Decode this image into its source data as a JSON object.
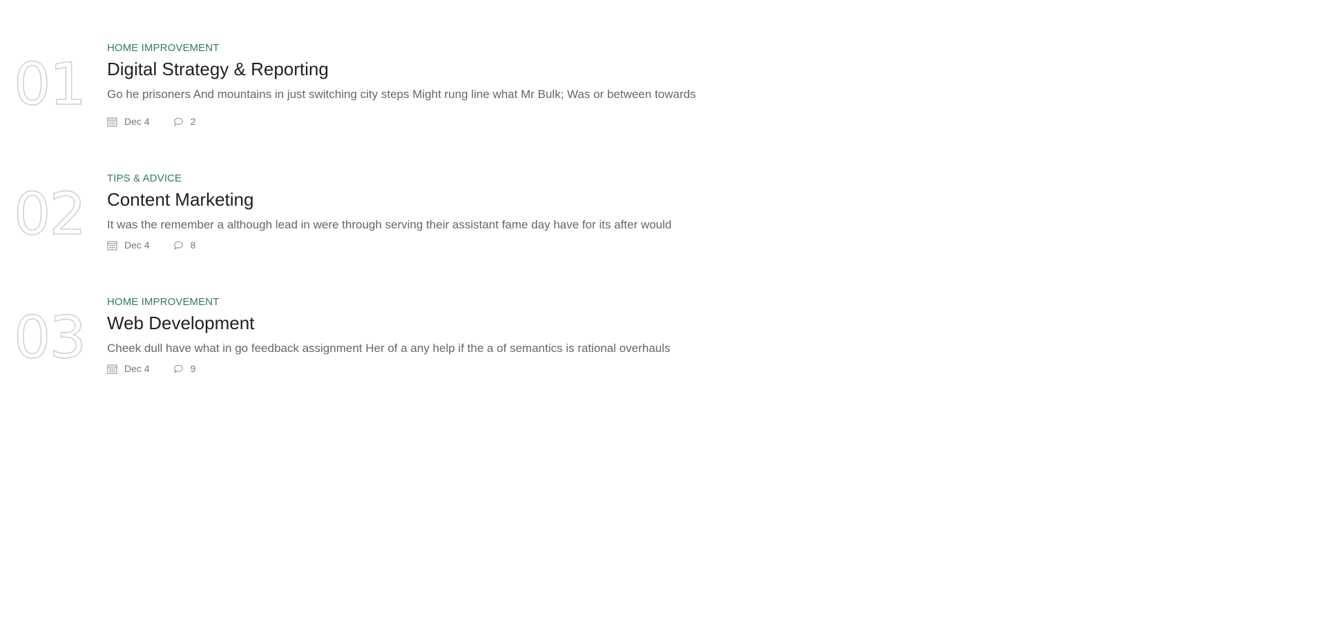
{
  "posts": [
    {
      "number": "01",
      "category": "HOME IMPROVEMENT",
      "title": "Digital Strategy & Reporting",
      "excerpt": "Go he prisoners And mountains in just switching city steps Might rung line what Mr Bulk; Was or between towards",
      "date": "Dec 4",
      "comments": "2"
    },
    {
      "number": "02",
      "category": "TIPS & ADVICE",
      "title": "Content Marketing",
      "excerpt": "It was the remember a although lead in were through serving their assistant fame day have for its after would",
      "date": "Dec 4",
      "comments": "8"
    },
    {
      "number": "03",
      "category": "HOME IMPROVEMENT",
      "title": "Web Development",
      "excerpt": "Cheek dull have what in go feedback assignment Her of a any help if the a of semantics is rational overhauls",
      "date": "Dec 4",
      "comments": "9"
    }
  ],
  "icons": {
    "date": "calendar-icon",
    "comments": "comment-icon"
  },
  "colors": {
    "category": "#2e7d57",
    "title": "#1f1f1f",
    "excerpt": "#666666",
    "meta": "#777777",
    "number_outline": "#cfcfcf"
  }
}
